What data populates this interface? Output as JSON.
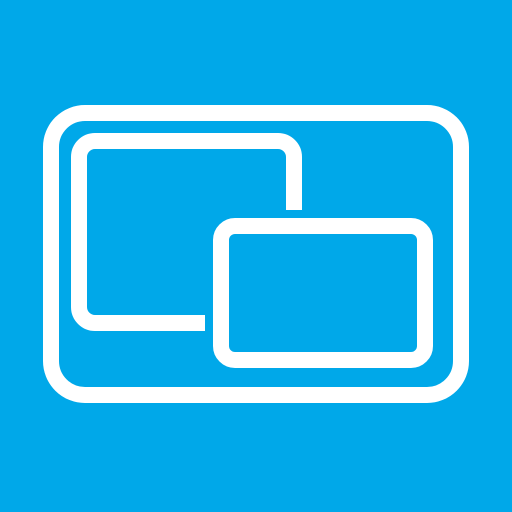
{
  "icon": {
    "name": "picture-in-picture-icon",
    "colors": {
      "background": "#00a8e9",
      "foreground": "#ffffff"
    }
  }
}
